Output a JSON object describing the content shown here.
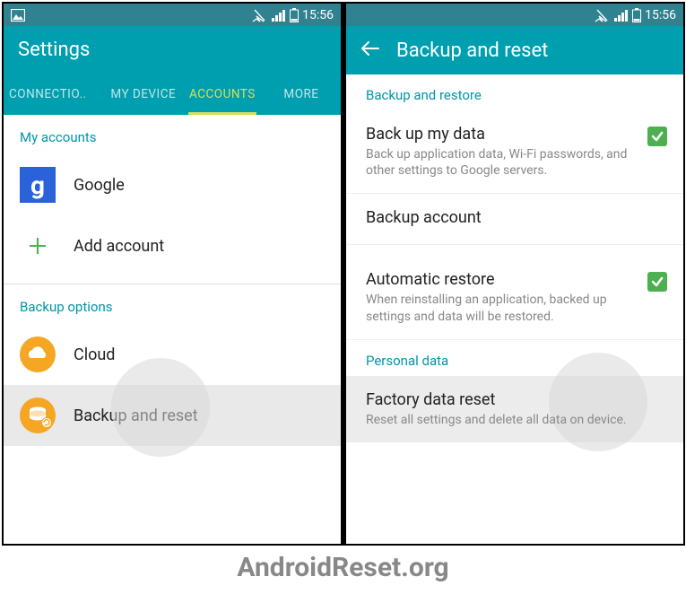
{
  "statusbar": {
    "time": "15:56"
  },
  "left": {
    "title": "Settings",
    "tabs": {
      "connections": "CONNECTIO..",
      "mydevice": "MY DEVICE",
      "accounts": "ACCOUNTS",
      "more": "MORE"
    },
    "section_accounts": "My accounts",
    "google": "Google",
    "add_account": "Add account",
    "section_backup": "Backup options",
    "cloud": "Cloud",
    "backup_reset": "Backup and reset"
  },
  "right": {
    "title": "Backup and reset",
    "section_restore": "Backup and restore",
    "backup_data": {
      "title": "Back up my data",
      "desc": "Back up application data, Wi-Fi passwords, and other settings to Google servers."
    },
    "backup_account": {
      "title": "Backup account"
    },
    "auto_restore": {
      "title": "Automatic restore",
      "desc": "When reinstalling an application, backed up settings and data will be restored."
    },
    "section_personal": "Personal data",
    "factory_reset": {
      "title": "Factory data reset",
      "desc": "Reset all settings and delete all data on device."
    }
  },
  "watermark": "AndroidReset.org"
}
